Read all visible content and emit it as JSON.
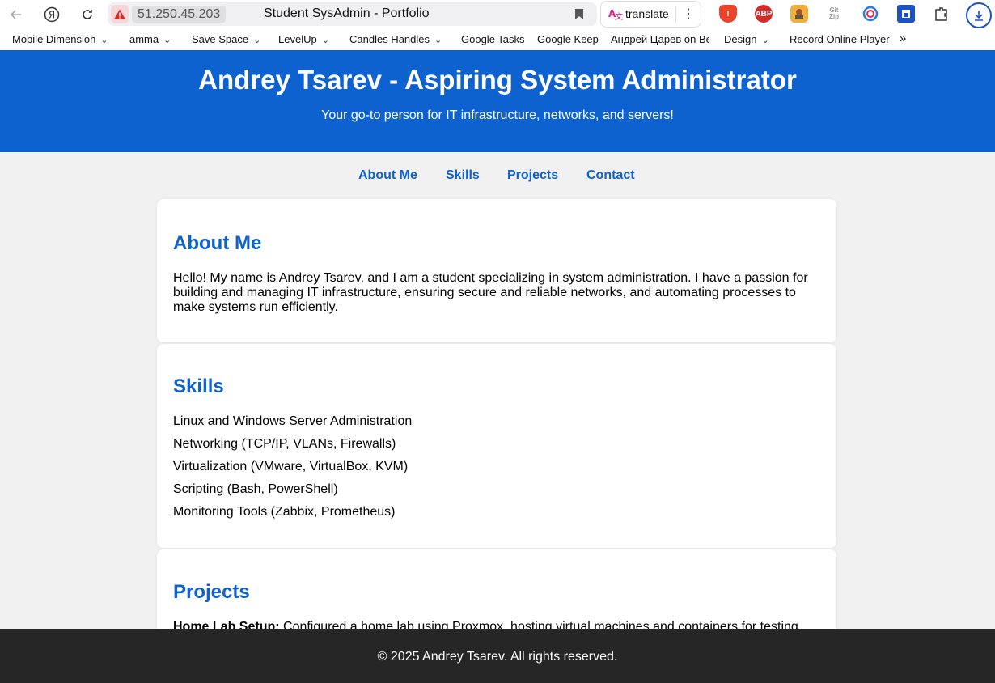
{
  "browser": {
    "address": "51.250.45.203",
    "tab_title": "Student SysAdmin - Portfolio",
    "translate_label": "translate",
    "extensions": [
      "shield-extension",
      "adblock-plus-extension",
      "ext-icon-1",
      "gitzip-extension",
      "ext-icon-2",
      "ext-icon-3",
      "ext-icon-4"
    ],
    "abp_text": "ABP",
    "gitzip_text": "Git Zip"
  },
  "bookmarks": [
    {
      "label": "Mobile Dimension",
      "has_menu": true
    },
    {
      "label": "amma",
      "has_menu": true
    },
    {
      "label": "Save Space",
      "has_menu": true
    },
    {
      "label": "LevelUp",
      "has_menu": true
    },
    {
      "label": "Candles Handles",
      "has_menu": true
    },
    {
      "label": "Google Tasks",
      "has_menu": false
    },
    {
      "label": "Google Keep",
      "has_menu": false
    },
    {
      "label": "Андрей Царев on Be",
      "has_menu": false
    },
    {
      "label": "Design",
      "has_menu": true
    },
    {
      "label": "Record Online Player",
      "has_menu": false
    }
  ],
  "overflow_label": "»",
  "header": {
    "title": "Andrey Tsarev - Aspiring System Administrator",
    "subtitle": "Your go-to person for IT infrastructure, networks, and servers!"
  },
  "nav": [
    "About Me",
    "Skills",
    "Projects",
    "Contact"
  ],
  "about": {
    "heading": "About Me",
    "text": "Hello! My name is Andrey Tsarev, and I am a student specializing in system administration. I have a passion for building and managing IT infrastructure, ensuring secure and reliable networks, and automating processes to make systems run efficiently."
  },
  "skills": {
    "heading": "Skills",
    "items": [
      "Linux and Windows Server Administration",
      "Networking (TCP/IP, VLANs, Firewalls)",
      "Virtualization (VMware, VirtualBox, KVM)",
      "Scripting (Bash, PowerShell)",
      "Monitoring Tools (Zabbix, Prometheus)"
    ]
  },
  "projects": {
    "heading": "Projects",
    "first_title": "Home Lab Setup:",
    "first_text": " Configured a home lab using Proxmox, hosting virtual machines and containers for testing"
  },
  "footer": {
    "text": "© 2025 Andrey Tsarev. All rights reserved."
  },
  "colors": {
    "brand": "#0d62d0",
    "footer": "#262626",
    "background": "#f1f1f1"
  }
}
